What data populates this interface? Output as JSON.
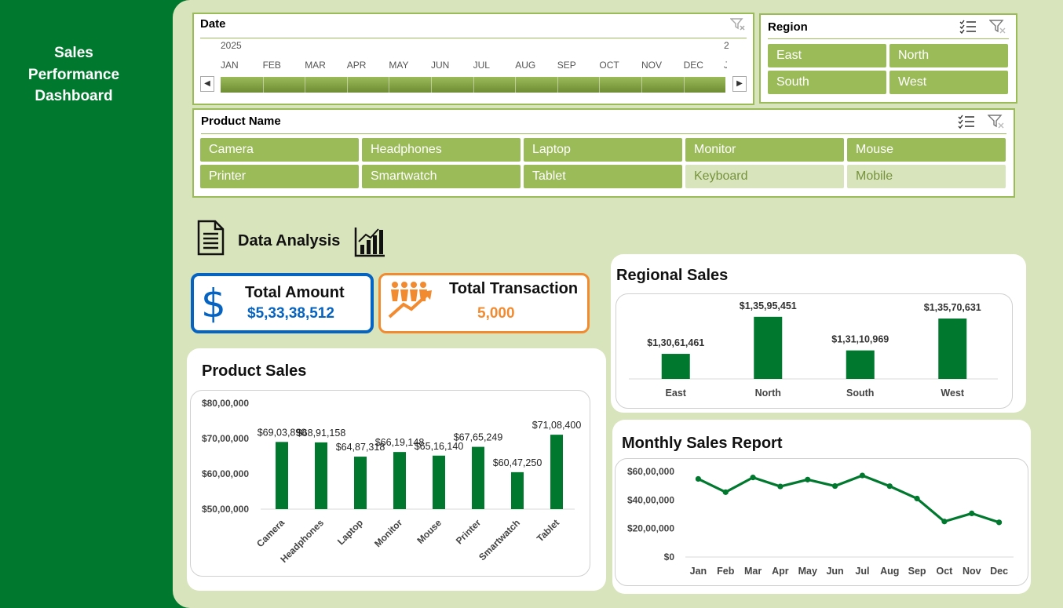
{
  "sidebar": {
    "title": "Sales Performance Dashboard"
  },
  "colors": {
    "brand": "#00792f",
    "accent": "#9bbb59",
    "background": "#d8e4bc",
    "blue": "#0563c1",
    "orange": "#f28b30"
  },
  "date_slicer": {
    "title": "Date",
    "year": "2025",
    "next_year_partial": "2",
    "months": [
      "JAN",
      "FEB",
      "MAR",
      "APR",
      "MAY",
      "JUN",
      "JUL",
      "AUG",
      "SEP",
      "OCT",
      "NOV",
      "DEC"
    ],
    "trailing_month_partial": "J",
    "icons": {
      "clear_filter": "clear-filter-icon",
      "scroll_left": "scroll-left-icon",
      "scroll_right": "scroll-right-icon"
    }
  },
  "region_slicer": {
    "title": "Region",
    "items": [
      {
        "label": "East",
        "selected": true
      },
      {
        "label": "North",
        "selected": true
      },
      {
        "label": "South",
        "selected": true
      },
      {
        "label": "West",
        "selected": true
      }
    ],
    "icons": {
      "multi_select": "multi-select-icon",
      "clear_filter": "clear-filter-icon"
    }
  },
  "product_slicer": {
    "title": "Product Name",
    "items": [
      {
        "label": "Camera",
        "selected": true
      },
      {
        "label": "Headphones",
        "selected": true
      },
      {
        "label": "Laptop",
        "selected": true
      },
      {
        "label": "Monitor",
        "selected": true
      },
      {
        "label": "Mouse",
        "selected": true
      },
      {
        "label": "Printer",
        "selected": true
      },
      {
        "label": "Smartwatch",
        "selected": true
      },
      {
        "label": "Tablet",
        "selected": true
      },
      {
        "label": "Keyboard",
        "selected": false
      },
      {
        "label": "Mobile",
        "selected": false
      }
    ],
    "icons": {
      "multi_select": "multi-select-icon",
      "clear_filter": "clear-filter-icon"
    }
  },
  "analysis": {
    "title": "Data Analysis",
    "icons": {
      "left": "document-icon",
      "right": "bar-chart-icon"
    }
  },
  "kpis": {
    "total_amount": {
      "label": "Total Amount",
      "value": "$5,33,38,512",
      "icon": "dollar-icon"
    },
    "total_transaction": {
      "label": "Total Transaction",
      "value": "5,000",
      "icon": "people-growth-icon"
    }
  },
  "product_sales": {
    "title": "Product Sales",
    "chart_data": {
      "type": "bar",
      "categories": [
        "Camera",
        "Headphones",
        "Laptop",
        "Monitor",
        "Mouse",
        "Printer",
        "Smartwatch",
        "Tablet"
      ],
      "values": [
        6903890,
        6891158,
        6487318,
        6619148,
        6516140,
        6765249,
        6047250,
        7108400
      ],
      "data_labels": [
        "$69,03,890",
        "$68,91,158",
        "$64,87,318",
        "$66,19,148",
        "$65,16,140",
        "$67,65,249",
        "$60,47,250",
        "$71,08,400"
      ],
      "ylim": [
        5000000,
        8000000
      ],
      "y_ticks": [
        5000000,
        6000000,
        7000000,
        8000000
      ],
      "y_tick_labels": [
        "$50,00,000",
        "$60,00,000",
        "$70,00,000",
        "$80,00,000"
      ],
      "grid": false,
      "color": "#00792f"
    }
  },
  "regional_sales": {
    "title": "Regional Sales",
    "chart_data": {
      "type": "bar",
      "categories": [
        "East",
        "North",
        "South",
        "West"
      ],
      "values": [
        13061461,
        13595451,
        13110969,
        13570631
      ],
      "data_labels": [
        "$1,30,61,461",
        "$1,35,95,451",
        "$1,31,10,969",
        "$1,35,70,631"
      ],
      "ylim": [
        12700000,
        13650000
      ],
      "grid": false,
      "color": "#00792f"
    }
  },
  "monthly_sales": {
    "title": "Monthly Sales Report",
    "chart_data": {
      "type": "line",
      "categories": [
        "Jan",
        "Feb",
        "Mar",
        "Apr",
        "May",
        "Jun",
        "Jul",
        "Aug",
        "Sep",
        "Oct",
        "Nov",
        "Dec"
      ],
      "values": [
        5480000,
        4550000,
        5580000,
        4950000,
        5430000,
        4980000,
        5720000,
        4970000,
        4100000,
        2490000,
        3060000,
        2430000
      ],
      "ylim": [
        0,
        6000000
      ],
      "y_ticks": [
        0,
        2000000,
        4000000,
        6000000
      ],
      "y_tick_labels": [
        "$0",
        "$20,00,000",
        "$40,00,000",
        "$60,00,000"
      ],
      "grid": false,
      "color": "#00792f"
    }
  }
}
